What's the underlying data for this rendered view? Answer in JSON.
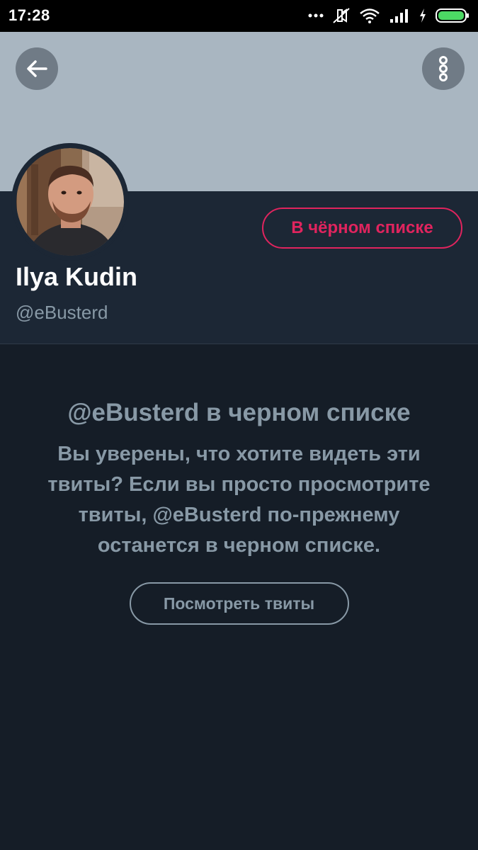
{
  "status_bar": {
    "time": "17:28",
    "icons": [
      "dots-icon",
      "mute-icon",
      "wifi-icon",
      "signal-icon",
      "charging-icon",
      "battery-icon"
    ],
    "battery_color": "#4cd964"
  },
  "header": {
    "back_icon": "arrow-left-icon",
    "more_icon": "vertical-dots-icon"
  },
  "profile": {
    "display_name": "Ilya Kudin",
    "username": "@eBusterd",
    "blocked_button_label": "В чёрном списке",
    "accent_color": "#e0245e"
  },
  "blocked_notice": {
    "title": "@eBusterd в черном списке",
    "description": "Вы уверены, что хотите видеть эти твиты? Если вы просто просмотрите твиты, @eBusterd по-прежнему останется в черном списке.",
    "view_button_label": "Посмотреть твиты"
  }
}
